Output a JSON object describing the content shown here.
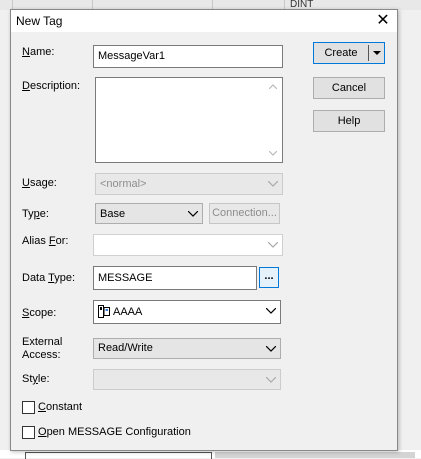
{
  "background": {
    "cell_text": "DINT"
  },
  "dialog": {
    "title": "New Tag",
    "fields": {
      "name": {
        "label": "Name:",
        "value": "MessageVar1"
      },
      "description": {
        "label": "Description:",
        "value": ""
      },
      "usage": {
        "label": "Usage:",
        "value": "<normal>"
      },
      "type": {
        "label": "Type:",
        "value": "Base",
        "connection_button": "Connection..."
      },
      "alias_for": {
        "label": "Alias For:",
        "value": ""
      },
      "data_type": {
        "label": "Data Type:",
        "value": "MESSAGE",
        "browse_button": "..."
      },
      "scope": {
        "label": "Scope:",
        "value": "AAAA"
      },
      "external_access": {
        "label_line1": "External",
        "label_line2": "Access:",
        "value": "Read/Write"
      },
      "style": {
        "label": "Style:",
        "value": ""
      }
    },
    "checkboxes": {
      "constant": {
        "label": "Constant",
        "checked": false
      },
      "open_config": {
        "label": "Open MESSAGE Configuration",
        "checked": false
      }
    },
    "buttons": {
      "create": "Create",
      "cancel": "Cancel",
      "help": "Help"
    }
  }
}
